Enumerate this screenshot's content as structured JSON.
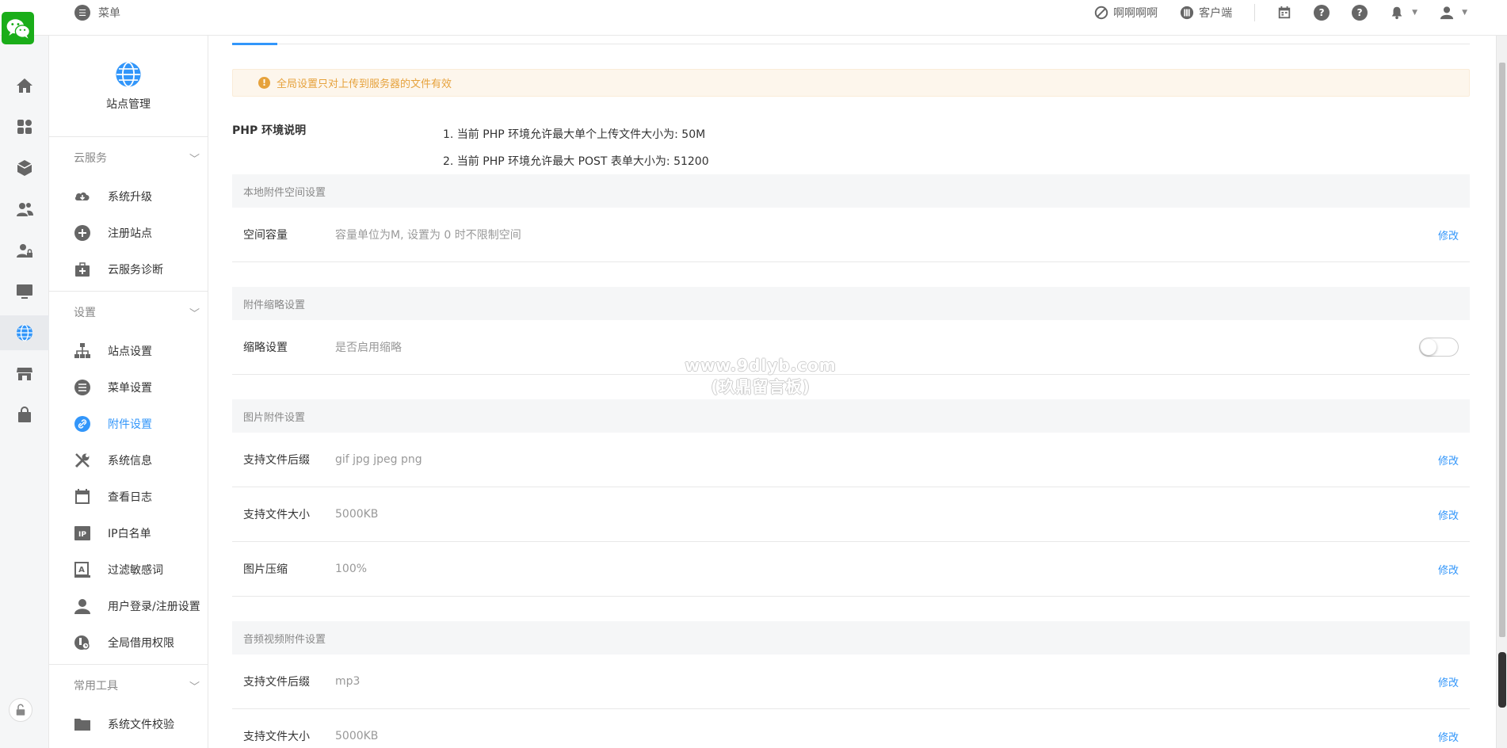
{
  "header": {
    "menu_label": "菜单",
    "account_name": "啊啊啊啊",
    "client_label": "客户端"
  },
  "site": {
    "title": "站点管理"
  },
  "groups": {
    "cloud": {
      "title": "云服务",
      "items": [
        {
          "label": "系统升级",
          "icon": "cloud-download-icon"
        },
        {
          "label": "注册站点",
          "icon": "plus-circle-icon"
        },
        {
          "label": "云服务诊断",
          "icon": "medkit-icon"
        }
      ]
    },
    "settings": {
      "title": "设置",
      "items": [
        {
          "label": "站点设置",
          "icon": "sitemap-icon"
        },
        {
          "label": "菜单设置",
          "icon": "list-icon"
        },
        {
          "label": "附件设置",
          "icon": "link-icon"
        },
        {
          "label": "系统信息",
          "icon": "tools-icon"
        },
        {
          "label": "查看日志",
          "icon": "calendar-icon"
        },
        {
          "label": "IP白名单",
          "icon": "ip-icon"
        },
        {
          "label": "过滤敏感词",
          "icon": "filter-text-icon"
        },
        {
          "label": "用户登录/注册设置",
          "icon": "user-icon"
        },
        {
          "label": "全局借用权限",
          "icon": "permission-icon"
        }
      ]
    },
    "tools": {
      "title": "常用工具",
      "items": [
        {
          "label": "系统文件校验",
          "icon": "folder-icon"
        }
      ]
    }
  },
  "notice": "全局设置只对上传到服务器的文件有效",
  "php": {
    "title": "PHP 环境说明",
    "lines": [
      "1. 当前 PHP 环境允许最大单个上传文件大小为: 50M",
      "2. 当前 PHP 环境允许最大 POST 表单大小为: 51200"
    ]
  },
  "sections": {
    "local": {
      "title": "本地附件空间设置",
      "rows": [
        {
          "label": "空间容量",
          "value": "容量单位为M, 设置为 0 时不限制空间",
          "action": "修改"
        }
      ]
    },
    "thumb": {
      "title": "附件缩略设置",
      "rows": [
        {
          "label": "缩略设置",
          "value": "是否启用缩略",
          "toggle": false
        }
      ]
    },
    "image": {
      "title": "图片附件设置",
      "rows": [
        {
          "label": "支持文件后缀",
          "value": "gif jpg jpeg png",
          "action": "修改"
        },
        {
          "label": "支持文件大小",
          "value": "5000KB",
          "action": "修改"
        },
        {
          "label": "图片压缩",
          "value": "100%",
          "action": "修改"
        }
      ]
    },
    "media": {
      "title": "音频视频附件设置",
      "rows": [
        {
          "label": "支持文件后缀",
          "value": "mp3",
          "action": "修改"
        },
        {
          "label": "支持文件大小",
          "value": "5000KB",
          "action": "修改"
        }
      ]
    }
  },
  "watermark": {
    "line1": "www.9dlyb.com",
    "line2": "(玖鼎留言板)"
  },
  "colors": {
    "accent": "#3296fa",
    "warning": "#e6a23c",
    "wechat": "#1aad19"
  }
}
